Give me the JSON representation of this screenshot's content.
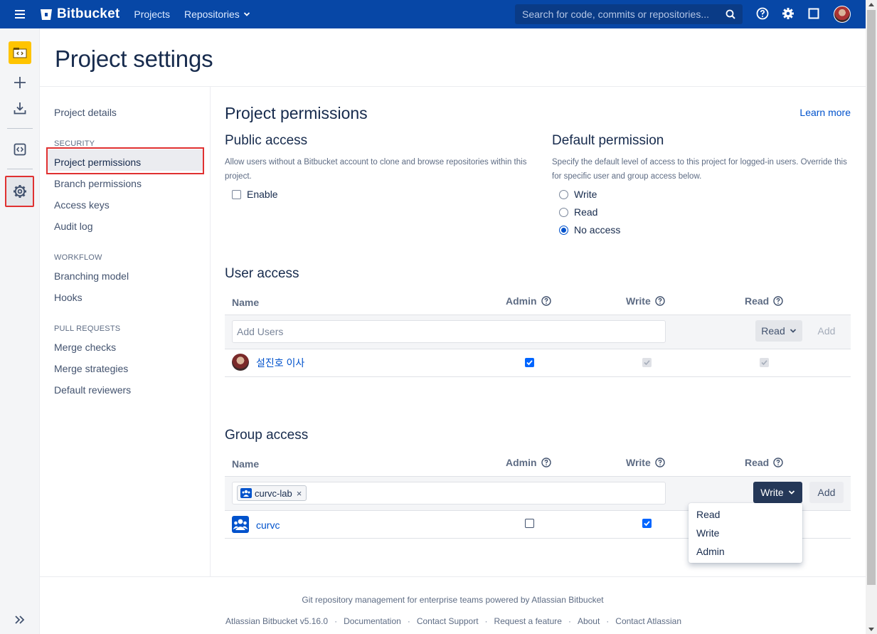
{
  "topbar": {
    "brand": "Bitbucket",
    "nav_projects": "Projects",
    "nav_repositories": "Repositories",
    "search_placeholder": "Search for code, commits or repositories..."
  },
  "page": {
    "title": "Project settings"
  },
  "settings_nav": {
    "project_details": "Project details",
    "security_heading": "SECURITY",
    "project_permissions": "Project permissions",
    "branch_permissions": "Branch permissions",
    "access_keys": "Access keys",
    "audit_log": "Audit log",
    "workflow_heading": "WORKFLOW",
    "branching_model": "Branching model",
    "hooks": "Hooks",
    "pull_requests_heading": "PULL REQUESTS",
    "merge_checks": "Merge checks",
    "merge_strategies": "Merge strategies",
    "default_reviewers": "Default reviewers"
  },
  "permissions": {
    "title": "Project permissions",
    "learn_more": "Learn more",
    "public_access": {
      "title": "Public access",
      "description": "Allow users without a Bitbucket account to clone and browse repositories within this project.",
      "enable_label": "Enable",
      "enabled": false
    },
    "default_permission": {
      "title": "Default permission",
      "description": "Specify the default level of access to this project for logged-in users. Override this for specific user and group access below.",
      "options": [
        "Write",
        "Read",
        "No access"
      ],
      "selected": "No access"
    }
  },
  "user_access": {
    "title": "User access",
    "col_name": "Name",
    "col_admin": "Admin",
    "col_write": "Write",
    "col_read": "Read",
    "add_placeholder": "Add Users",
    "permission_select": "Read",
    "add_button": "Add",
    "rows": [
      {
        "name": "설진호 이사",
        "admin": true,
        "write": true,
        "read": true
      }
    ]
  },
  "group_access": {
    "title": "Group access",
    "col_name": "Name",
    "col_admin": "Admin",
    "col_write": "Write",
    "col_read": "Read",
    "chip_label": "curvc-lab",
    "chip_remove": "×",
    "permission_select": "Write",
    "add_button": "Add",
    "rows": [
      {
        "name": "curvc",
        "admin": false,
        "write": true
      }
    ],
    "dropdown_options": [
      "Read",
      "Write",
      "Admin"
    ]
  },
  "footer": {
    "tagline": "Git repository management for enterprise teams powered by Atlassian Bitbucket",
    "version": "Atlassian Bitbucket v5.16.0",
    "documentation": "Documentation",
    "contact_support": "Contact Support",
    "request_feature": "Request a feature",
    "about": "About",
    "contact_atlassian": "Contact Atlassian",
    "separator": "·"
  },
  "colors": {
    "topbar": "#0747a6",
    "link": "#0052cc",
    "highlight_border": "#e03131",
    "project_avatar": "#ffc400"
  }
}
